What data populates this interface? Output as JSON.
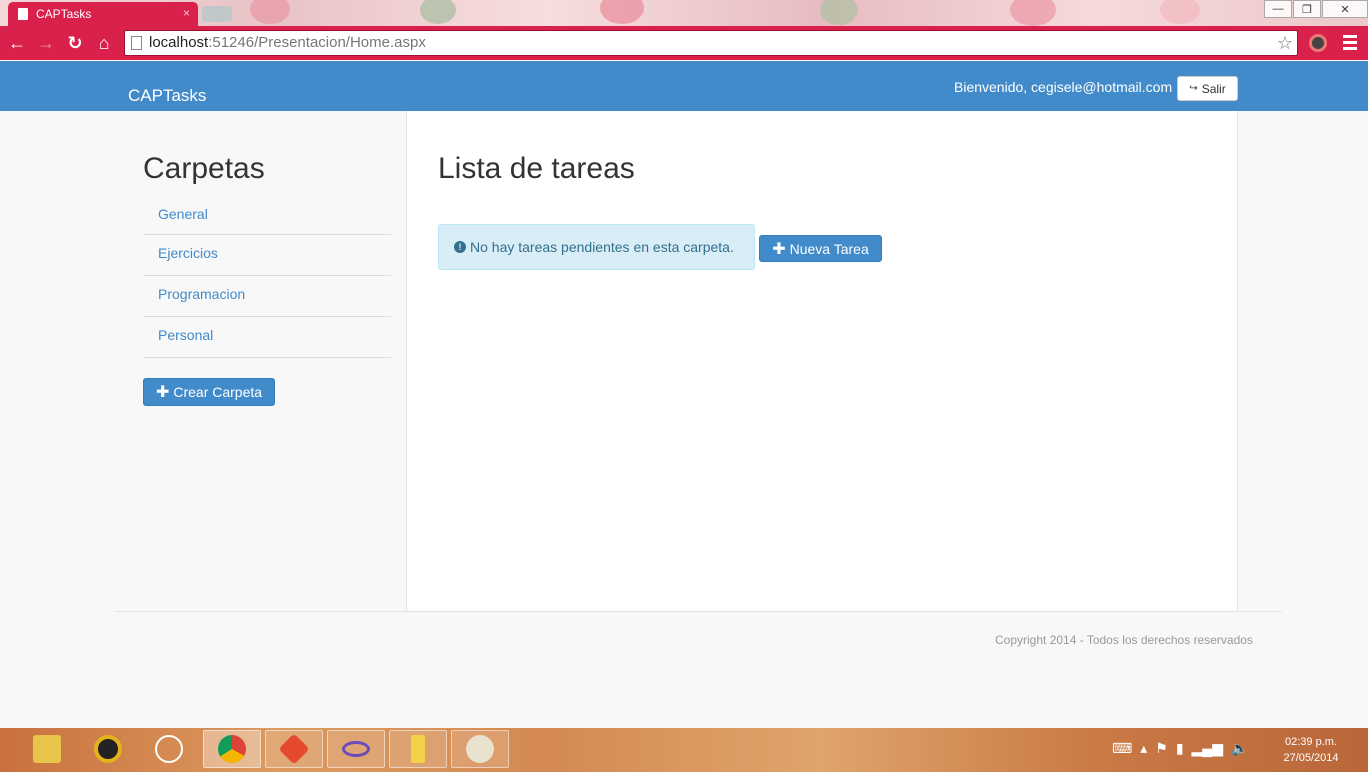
{
  "browser": {
    "tab_title": "CAPTasks",
    "tab_close": "×",
    "url_host": "localhost",
    "url_path": ":51246/Presentacion/Home.aspx",
    "back": "←",
    "forward": "→",
    "reload": "↻",
    "home": "⌂",
    "bookmark": "☆",
    "win_minimize": "—",
    "win_restore": "❐",
    "win_close": "✕"
  },
  "navbar": {
    "brand": "CAPTasks",
    "welcome": "Bienvenido, cegisele@hotmail.com",
    "logout_label": "Salir",
    "logout_icon": "↪"
  },
  "sidebar": {
    "title": "Carpetas",
    "folders": [
      "General",
      "Ejercicios",
      "Programacion",
      "Personal"
    ],
    "create_button": "Crear Carpeta",
    "plus": "✚"
  },
  "main": {
    "title": "Lista de tareas",
    "alert_icon": "!",
    "alert_text": "No hay tareas pendientes en esta carpeta.",
    "new_task_button": "Nueva Tarea"
  },
  "footer": {
    "copyright": "Copyright 2014 - Todos los derechos reservados"
  },
  "taskbar": {
    "time": "02:39 p.m.",
    "date": "27/05/2014",
    "apps": [
      "file-explorer-icon",
      "media-player-icon",
      "hp-icon",
      "chrome-icon",
      "git-icon",
      "visual-studio-icon",
      "paint-tool-icon",
      "paint-palette-icon"
    ]
  },
  "colors": {
    "primary": "#428bca",
    "browser_accent": "#d9214b",
    "alert_bg": "#d9edf7",
    "alert_text": "#31708f"
  }
}
